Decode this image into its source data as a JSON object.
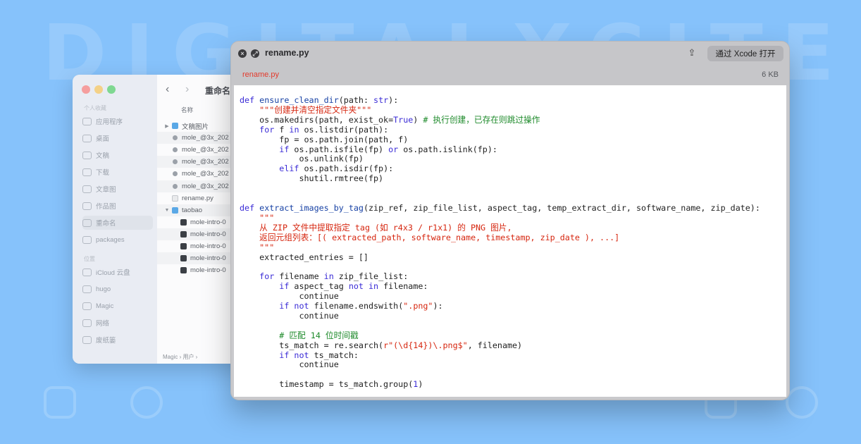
{
  "background": {
    "watermark": "DIGITALXCITE",
    "color": "#86c2fb"
  },
  "finder": {
    "title": "重命名",
    "traffic_lights": [
      "#ff5f57",
      "#febc2e",
      "#28c840"
    ],
    "sidebar_section_favorites": "个人收藏",
    "sidebar_section_locations": "位置",
    "sidebar_items": [
      {
        "label": "应用程序",
        "icon": "apps-icon"
      },
      {
        "label": "桌面",
        "icon": "desktop-icon"
      },
      {
        "label": "文稿",
        "icon": "document-icon"
      },
      {
        "label": "下载",
        "icon": "download-icon"
      },
      {
        "label": "文章图",
        "icon": "folder-icon"
      },
      {
        "label": "作品图",
        "icon": "folder-icon"
      },
      {
        "label": "重命名",
        "icon": "folder-icon"
      },
      {
        "label": "packages",
        "icon": "folder-icon"
      },
      {
        "label": "iCloud 云盘",
        "icon": "cloud-icon"
      },
      {
        "label": "hugo",
        "icon": "home-icon"
      },
      {
        "label": "Magic",
        "icon": "computer-icon"
      },
      {
        "label": "网络",
        "icon": "network-icon"
      },
      {
        "label": "废纸篓",
        "icon": "trash-icon"
      }
    ],
    "column_header": "名称",
    "files": [
      {
        "name": "文稿图片",
        "type": "folder",
        "indent": 0,
        "chevron": "▶"
      },
      {
        "name": "mole_@3x_202",
        "type": "file",
        "indent": 0,
        "chevron": ""
      },
      {
        "name": "mole_@3x_202",
        "type": "file",
        "indent": 0,
        "chevron": ""
      },
      {
        "name": "mole_@3x_202",
        "type": "file",
        "indent": 0,
        "chevron": ""
      },
      {
        "name": "mole_@3x_202",
        "type": "file",
        "indent": 0,
        "chevron": ""
      },
      {
        "name": "mole_@3x_202",
        "type": "file",
        "indent": 0,
        "chevron": ""
      },
      {
        "name": "rename.py",
        "type": "py",
        "indent": 0,
        "chevron": ""
      },
      {
        "name": "taobao",
        "type": "folder",
        "indent": 0,
        "chevron": "▼"
      },
      {
        "name": "mole-intro-0",
        "type": "mov",
        "indent": 1,
        "chevron": ""
      },
      {
        "name": "mole-intro-0",
        "type": "mov",
        "indent": 1,
        "chevron": ""
      },
      {
        "name": "mole-intro-0",
        "type": "mov",
        "indent": 1,
        "chevron": ""
      },
      {
        "name": "mole-intro-0",
        "type": "mov",
        "indent": 1,
        "chevron": ""
      },
      {
        "name": "mole-intro-0",
        "type": "mov",
        "indent": 1,
        "chevron": ""
      }
    ],
    "path_bar": "Magic › 用户 › "
  },
  "quicklook": {
    "title": "rename.py",
    "file_label": "rename.py",
    "file_size": "6 KB",
    "open_button": "通过 Xcode 打开",
    "code_lines": [
      "def ensure_clean_dir(path: str):",
      "    \"\"\"创建并清空指定文件夹\"\"\"",
      "    os.makedirs(path, exist_ok=True) # 执行创建，已存在则跳过操作",
      "    for f in os.listdir(path):",
      "        fp = os.path.join(path, f)",
      "        if os.path.isfile(fp) or os.path.islink(fp):",
      "            os.unlink(fp)",
      "        elif os.path.isdir(fp):",
      "            shutil.rmtree(fp)",
      "",
      "",
      "def extract_images_by_tag(zip_ref, zip_file_list, aspect_tag, temp_extract_dir, software_name, zip_date):",
      "    \"\"\"",
      "    从 ZIP 文件中提取指定 tag (如 r4x3 / r1x1) 的 PNG 图片,",
      "    返回元组列表：[( extracted_path, software_name, timestamp, zip_date ), ...]",
      "    \"\"\"",
      "    extracted_entries = []",
      "",
      "    for filename in zip_file_list:",
      "        if aspect_tag not in filename:",
      "            continue",
      "        if not filename.endswith(\".png\"):",
      "            continue",
      "",
      "        # 匹配 14 位时间戳",
      "        ts_match = re.search(r\"(\\d{14})\\.png$\", filename)",
      "        if not ts_match:",
      "            continue",
      "",
      "        timestamp = ts_match.group(1)"
    ]
  }
}
